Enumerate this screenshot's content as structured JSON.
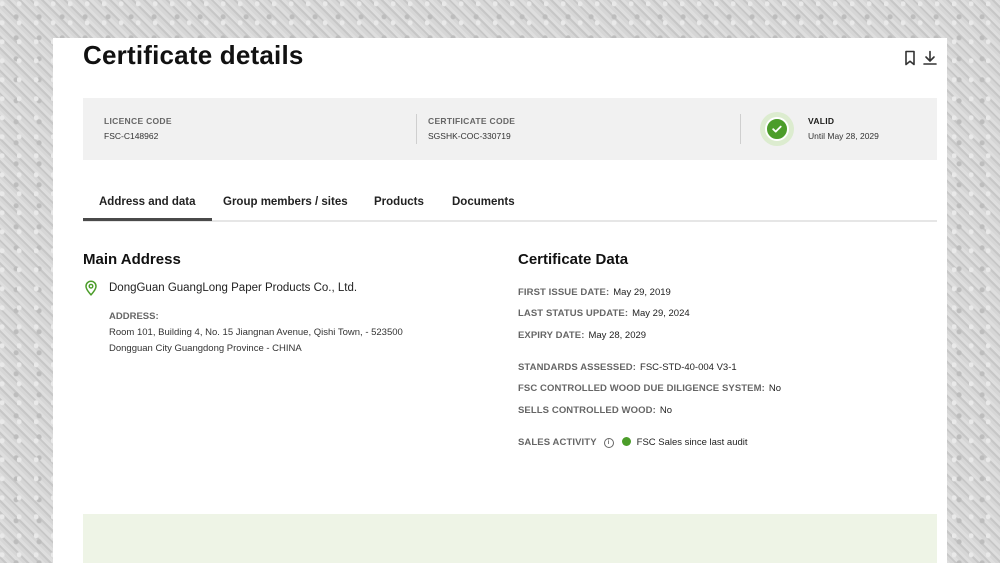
{
  "page": {
    "title": "Certificate details"
  },
  "toolbar": {
    "bookmark_icon": "bookmark-icon",
    "download_icon": "download-icon"
  },
  "summary": {
    "licence_code_label": "LICENCE CODE",
    "licence_code": "FSC-C148962",
    "certificate_code_label": "CERTIFICATE CODE",
    "certificate_code": "SGSHK-COC-330719",
    "status_label": "VALID",
    "status_until": "Until May 28, 2029",
    "status_color": "#4c9d2a"
  },
  "tabs": [
    {
      "label": "Address and data",
      "active": true
    },
    {
      "label": "Group members / sites"
    },
    {
      "label": "Products"
    },
    {
      "label": "Documents"
    }
  ],
  "main_address": {
    "heading": "Main Address",
    "company": "DongGuan GuangLong Paper Products Co., Ltd.",
    "address_label": "ADDRESS:",
    "address_line1": "Room 101, Building 4, No. 15 Jiangnan Avenue, Qishi Town, - 523500",
    "address_line2": "Dongguan City Guangdong Province - CHINA"
  },
  "certificate_data": {
    "heading": "Certificate Data",
    "first_issue_label": "FIRST ISSUE DATE:",
    "first_issue": "May 29, 2019",
    "last_status_label": "LAST STATUS UPDATE:",
    "last_status": "May 29, 2024",
    "expiry_label": "EXPIRY DATE:",
    "expiry": "May 28, 2029",
    "standards_label": "STANDARDS ASSESSED:",
    "standards": "FSC-STD-40-004 V3-1",
    "cw_label": "FSC CONTROLLED WOOD DUE DILIGENCE SYSTEM:",
    "cw": "No",
    "sells_cw_label": "SELLS CONTROLLED WOOD:",
    "sells_cw": "No",
    "sales_activity_label": "SALES ACTIVITY",
    "sales_activity": "FSC Sales since last audit"
  }
}
